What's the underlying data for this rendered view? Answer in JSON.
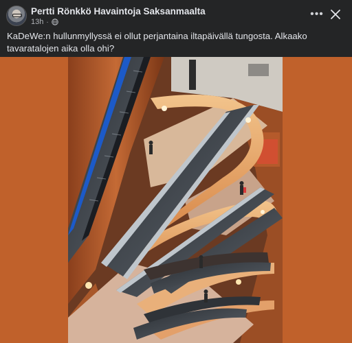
{
  "post": {
    "author": "Pertti Rönkkö Havaintoja Saksanmaalta",
    "time": "13h",
    "separator": "·",
    "caption": "KaDeWe:n hullunmyllyssä ei ollut perjantaina iltapäivällä tungosta. Alkaako tavaratalojen aika olla ohi?"
  },
  "actions": {
    "more_label": "•••"
  },
  "icons": {
    "audience": "globe-icon",
    "more": "more-options-icon",
    "close": "close-icon"
  },
  "colors": {
    "background": "#242526",
    "image_backdrop": "#c0612b",
    "text_primary": "#e4e6eb",
    "text_secondary": "#b0b3b8"
  }
}
